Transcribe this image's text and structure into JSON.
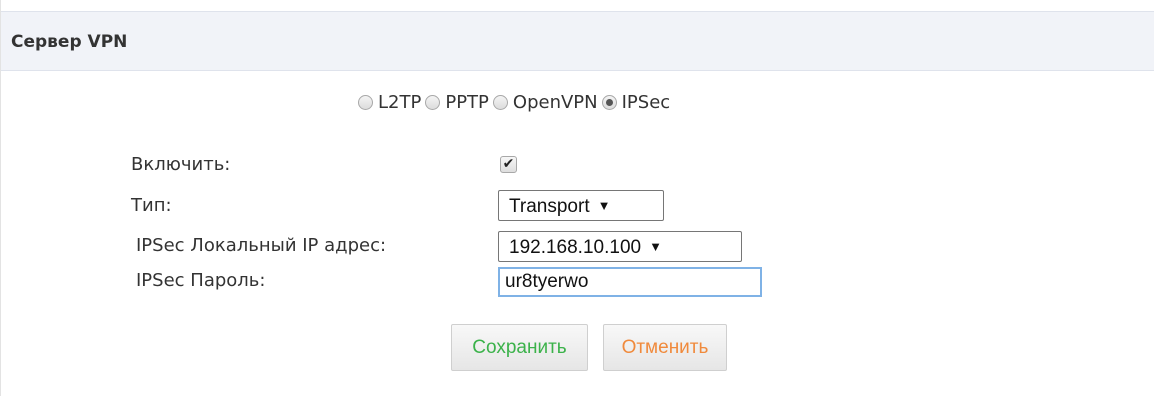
{
  "panel": {
    "title": "Сервер VPN"
  },
  "protocols": {
    "options": [
      {
        "label": "L2TP",
        "checked": false
      },
      {
        "label": "PPTP",
        "checked": false
      },
      {
        "label": "OpenVPN",
        "checked": false
      },
      {
        "label": "IPSec",
        "checked": true
      }
    ]
  },
  "form": {
    "enable": {
      "label": "Включить:",
      "checked": true
    },
    "type": {
      "label": "Тип:",
      "value": "Transport"
    },
    "local_ip": {
      "label": "IPSec Локальный IP адрес:",
      "value": "192.168.10.100"
    },
    "password": {
      "label": "IPSec Пароль:",
      "value": "ur8tyerwo"
    }
  },
  "buttons": {
    "save_label": "Сохранить",
    "cancel_label": "Отменить"
  },
  "colors": {
    "header_bg": "#f1f3f8",
    "save_text": "#3bb24a",
    "cancel_text": "#f08a3c",
    "input_focus_border": "#7fb2e6"
  }
}
